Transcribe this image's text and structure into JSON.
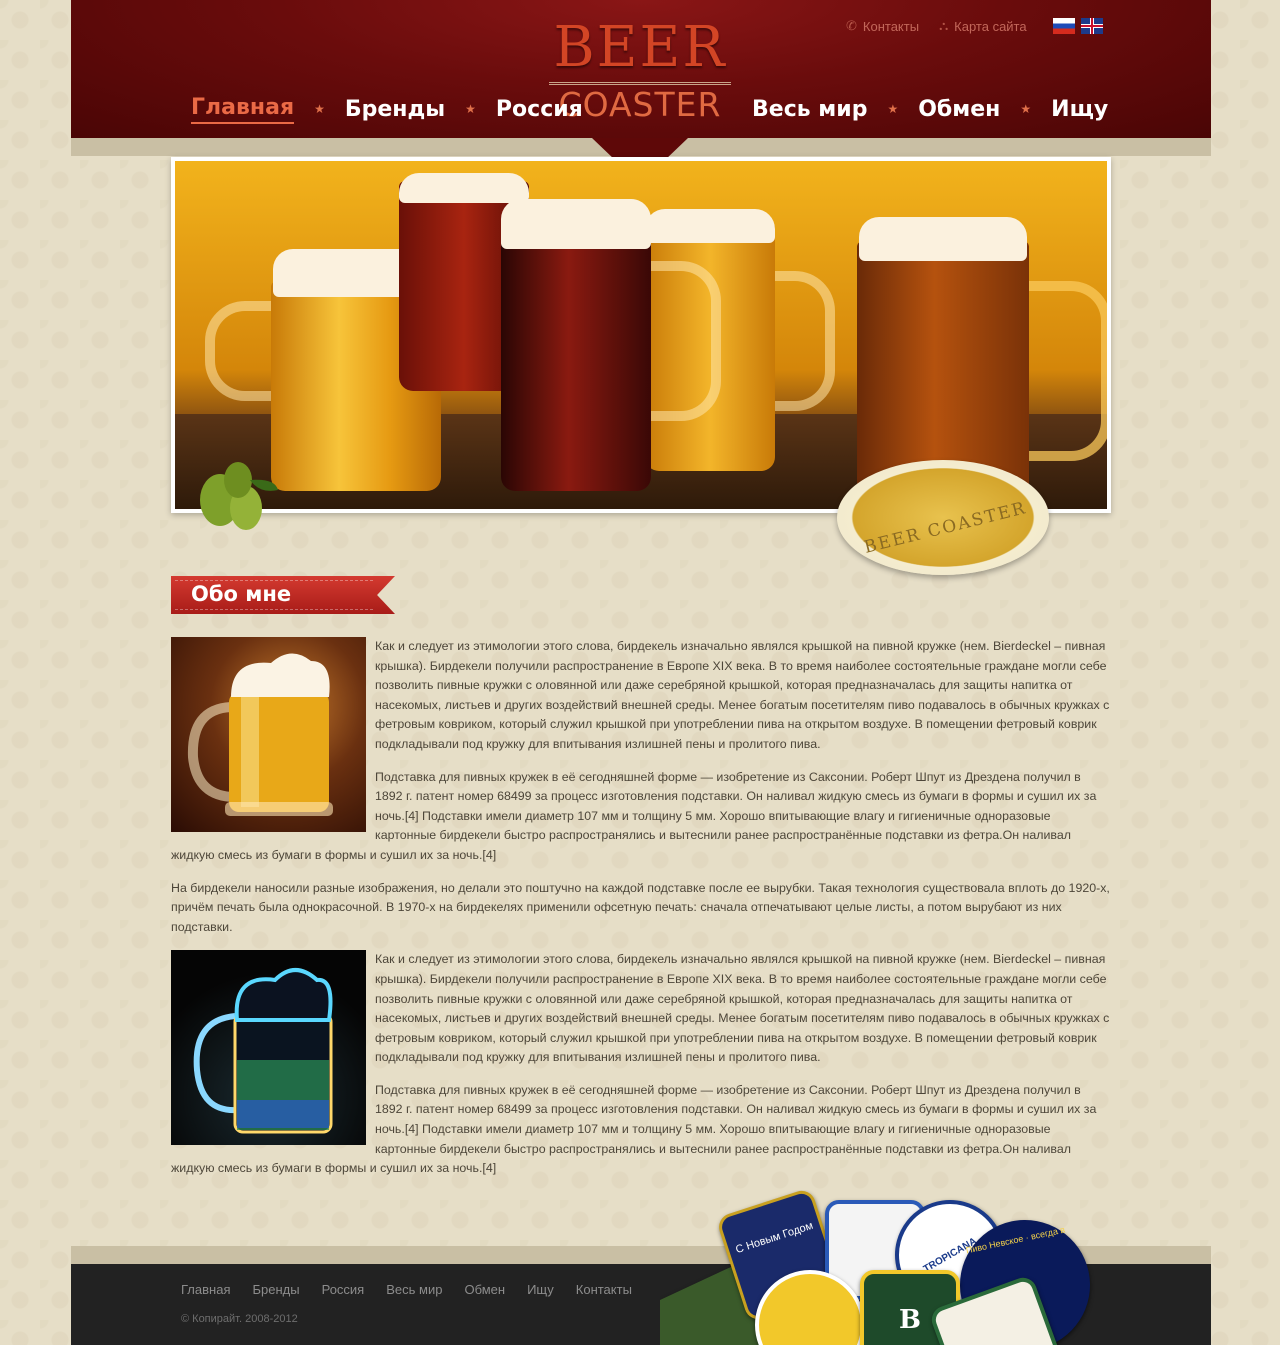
{
  "header": {
    "logo_top": "BEER",
    "logo_bottom": "COASTER",
    "nav_left": [
      "Главная",
      "Бренды",
      "Россия"
    ],
    "nav_right": [
      "Весь мир",
      "Обмен",
      "Ищу"
    ],
    "active_index": 0,
    "top_links": {
      "contacts": "Контакты",
      "sitemap": "Карта сайта"
    }
  },
  "banner": {
    "coaster_text": "BEER COASTER"
  },
  "section": {
    "title": "Обо мне"
  },
  "content": {
    "block1_p1": "Как и следует из этимологии этого слова, бирдекель изначально являлся крышкой на пивной кружке (нем. Bierdeckel – пивная крышка). Бирдекели получили распространение в Европе XIX века. В то время наиболее состоятельные граждане могли себе позволить пивные кружки с оловянной или даже серебряной крышкой, которая предназначалась для защиты напитка от насекомых, листьев и других воздействий внешней среды. Менее богатым посетителям пиво подавалось в обычных кружках с фетровым ковриком, который служил крышкой при употреблении пива на открытом воздухе. В помещении фетровый коврик подкладывали под кружку для впитывания излишней пены и пролитого пива.",
    "block1_p2": "Подставка для пивных кружек в её сегодняшней форме — изобретение из Саксонии. Роберт Шпут из Дрездена получил в 1892 г. патент номер 68499 за процесс изготовления подставки. Он наливал жидкую смесь из бумаги в формы и сушил их за ночь.[4] Подставки имели диаметр 107 мм и толщину 5 мм. Хорошо впитывающие влагу и гигиеничные одноразовые картонные бирдекели быстро распространялись и вытеснили ранее распространённые подставки из фетра.Он наливал жидкую смесь из бумаги в формы и сушил их за ночь.[4]",
    "middle_p": "На бирдекели наносили разные изображения, но делали это поштучно на каждой подставке после ее вырубки. Такая технология существовала вплоть до 1920-х, причём печать была однокрасочной. В 1970-х на бирдекелях применили офсетную печать: сначала отпечатывают целые листы, а потом вырубают из них подставки.",
    "block2_p1": "Как и следует из этимологии этого слова, бирдекель изначально являлся крышкой на пивной кружке (нем. Bierdeckel – пивная крышка). Бирдекели получили распространение в Европе XIX века. В то время наиболее состоятельные граждане могли себе позволить пивные кружки с оловянной или даже серебряной крышкой, которая предназначалась для защиты напитка от насекомых, листьев и других воздействий внешней среды. Менее богатым посетителям пиво подавалось в обычных кружках с фетровым ковриком, который служил крышкой при употреблении пива на открытом воздухе. В помещении фетровый коврик подкладывали под кружку для впитывания излишней пены и пролитого пива.",
    "block2_p2": "Подставка для пивных кружек в её сегодняшней форме — изобретение из Саксонии. Роберт Шпут из Дрездена получил в 1892 г. патент номер 68499 за процесс изготовления подставки. Он наливал жидкую смесь из бумаги в формы и сушил их за ночь.[4] Подставки имели диаметр 107 мм и толщину 5 мм. Хорошо впитывающие влагу и гигиеничные одноразовые картонные бирдекели быстро распространялись и вытеснили ранее распространённые подставки из фетра.Он наливал жидкую смесь из бумаги в формы и сушил их за ночь.[4]"
  },
  "footer": {
    "nav": [
      "Главная",
      "Бренды",
      "Россия",
      "Весь мир",
      "Обмен",
      "Ищу",
      "Контакты"
    ],
    "copyright": "© Копирайт. 2008-2012",
    "coaster_labels": [
      "С Новым Годом",
      "TROPICANA",
      "B",
      "Пиво Невское · всегда в"
    ]
  },
  "colors": {
    "header_red": "#6a0c0c",
    "accent_orange": "#ea6a46",
    "ribbon_red": "#c02a24",
    "footer_dark": "#222222",
    "page_beige": "#e6dec7"
  },
  "icons": [
    "phone-icon",
    "sitemap-icon",
    "flag-ru-icon",
    "flag-uk-icon",
    "star-separator-icon"
  ]
}
